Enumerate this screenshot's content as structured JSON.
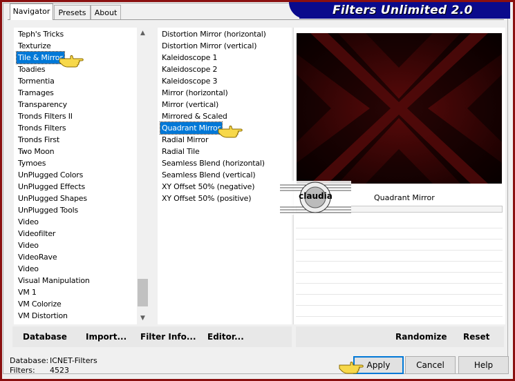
{
  "window": {
    "title": "Filters Unlimited 2.0",
    "frame_color": "#8a1010",
    "banner_color": "#0a0a8c"
  },
  "tabs": [
    {
      "label": "Navigator",
      "active": true
    },
    {
      "label": "Presets",
      "active": false
    },
    {
      "label": "About",
      "active": false
    }
  ],
  "categories": {
    "items": [
      "Teph's Tricks",
      "Texturize",
      "Tile & Mirror",
      "Toadies",
      "Tormentia",
      "Tramages",
      "Transparency",
      "Tronds Filters II",
      "Tronds Filters",
      "Tronds First",
      "Two Moon",
      "Tymoes",
      "UnPlugged Colors",
      "UnPlugged Effects",
      "UnPlugged Shapes",
      "UnPlugged Tools",
      "Video",
      "Videofilter",
      "Video",
      "VideoRave",
      "Video",
      "Visual Manipulation",
      "VM 1",
      "VM Colorize",
      "VM Distortion"
    ],
    "selected_index": 2
  },
  "filters": {
    "items": [
      "Distortion Mirror (horizontal)",
      "Distortion Mirror (vertical)",
      "Kaleidoscope 1",
      "Kaleidoscope 2",
      "Kaleidoscope 3",
      "Mirror (horizontal)",
      "Mirror (vertical)",
      "Mirrored & Scaled",
      "Quadrant Mirror",
      "Radial Mirror",
      "Radial Tile",
      "Seamless Blend (horizontal)",
      "Seamless Blend (vertical)",
      "XY Offset 50% (negative)",
      "XY Offset 50% (positive)"
    ],
    "selected_index": 8
  },
  "preview": {
    "filter_name": "Quadrant Mirror",
    "watermark_text": "claudia"
  },
  "left_bar": {
    "database": "Database",
    "import": "Import...",
    "filter_info": "Filter Info...",
    "editor": "Editor..."
  },
  "right_bar": {
    "randomize": "Randomize",
    "reset": "Reset"
  },
  "status": {
    "database_label": "Database:",
    "database_value": "ICNET-Filters",
    "filters_label": "Filters:",
    "filters_value": "4523"
  },
  "buttons": {
    "apply": "Apply",
    "cancel": "Cancel",
    "help": "Help"
  },
  "icons": {
    "pointer": "pointing-hand-icon",
    "scroll_up": "chevron-up-icon",
    "scroll_down": "chevron-down-icon"
  }
}
